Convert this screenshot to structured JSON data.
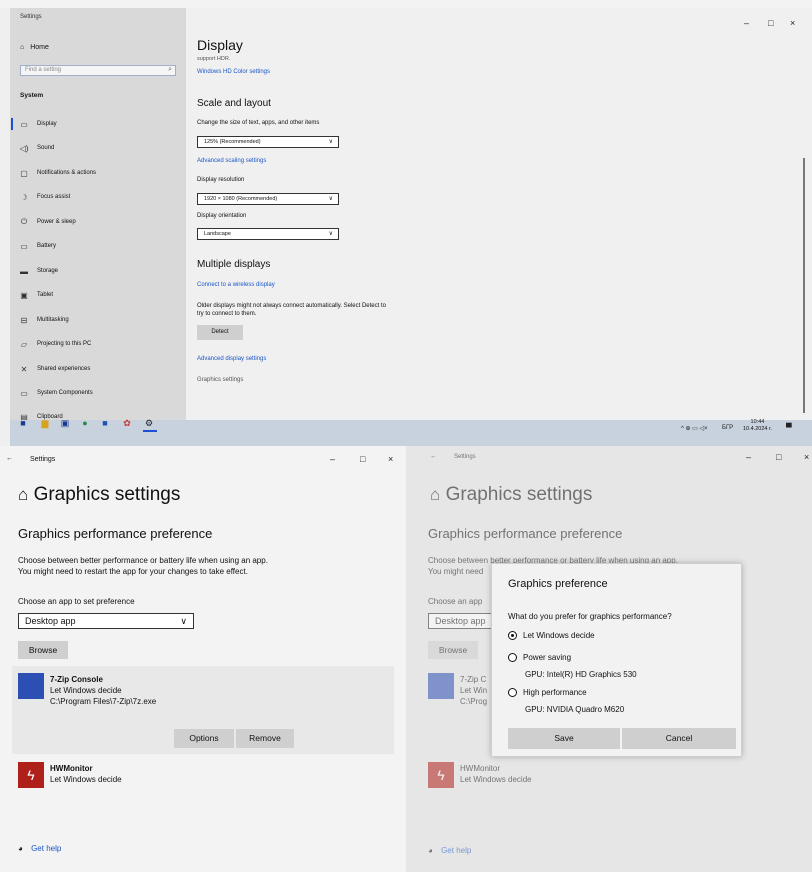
{
  "top_window": {
    "title": "Settings",
    "controls": {
      "minimize": "–",
      "maximize": "□",
      "close": "×"
    },
    "sidebar": {
      "home": "Home",
      "search_placeholder": "Find a setting",
      "section": "System",
      "items": [
        {
          "label": "Display",
          "icon": "monitor-icon"
        },
        {
          "label": "Sound",
          "icon": "speaker-icon"
        },
        {
          "label": "Notifications & actions",
          "icon": "notifications-icon"
        },
        {
          "label": "Focus assist",
          "icon": "moon-icon"
        },
        {
          "label": "Power & sleep",
          "icon": "power-icon"
        },
        {
          "label": "Battery",
          "icon": "battery-icon"
        },
        {
          "label": "Storage",
          "icon": "storage-icon"
        },
        {
          "label": "Tablet",
          "icon": "tablet-icon"
        },
        {
          "label": "Multitasking",
          "icon": "multitasking-icon"
        },
        {
          "label": "Projecting to this PC",
          "icon": "projecting-icon"
        },
        {
          "label": "Shared experiences",
          "icon": "shared-icon"
        },
        {
          "label": "System Components",
          "icon": "components-icon"
        },
        {
          "label": "Clipboard",
          "icon": "clipboard-icon"
        }
      ]
    },
    "main": {
      "title": "Display",
      "cutoff_text": "support HDR.",
      "hd_color_link": "Windows HD Color settings",
      "scale_heading": "Scale and layout",
      "scale_label": "Change the size of text, apps, and other items",
      "scale_value": "125% (Recommended)",
      "advanced_scaling_link": "Advanced scaling settings",
      "resolution_label": "Display resolution",
      "resolution_value": "1920 × 1080 (Recommended)",
      "orientation_label": "Display orientation",
      "orientation_value": "Landscape",
      "multiple_heading": "Multiple displays",
      "wireless_link": "Connect to a wireless display",
      "older_text_1": "Older displays might not always connect automatically. Select Detect to",
      "older_text_2": "try to connect to them.",
      "detect_button": "Detect",
      "advanced_display_link": "Advanced display settings",
      "graphics_settings_link": "Graphics settings"
    },
    "taskbar": {
      "language": "БГР",
      "time": "10:44",
      "date": "10.4.2024 г."
    }
  },
  "left_panel": {
    "header_title": "Settings",
    "controls": {
      "minimize": "–",
      "maximize": "□",
      "close": "×"
    },
    "page_title": "Graphics settings",
    "section_heading": "Graphics performance preference",
    "desc_1": "Choose between better performance or battery life when using an app.",
    "desc_2": "You might need to restart the app for your changes to take effect.",
    "choose_label": "Choose an app to set preference",
    "app_type_value": "Desktop app",
    "browse_button": "Browse",
    "apps": [
      {
        "name": "7-Zip Console",
        "preference": "Let Windows decide",
        "path": "C:\\Program Files\\7-Zip\\7z.exe"
      },
      {
        "name": "HWMonitor",
        "preference": "Let Windows decide"
      }
    ],
    "options_button": "Options",
    "remove_button": "Remove",
    "get_help": "Get help"
  },
  "right_panel": {
    "header_title": "Settings",
    "controls": {
      "minimize": "–",
      "maximize": "□",
      "close": "×"
    },
    "page_title": "Graphics settings",
    "section_heading": "Graphics performance preference",
    "desc_1": "Choose between better performance or battery life when using an app.",
    "desc_2": "You might need",
    "choose_label": "Choose an app",
    "app_type_value": "Desktop app",
    "browse_button": "Browse",
    "app1_name": "7-Zip C",
    "app1_pref": "Let Win",
    "app1_path": "C:\\Prog",
    "app2_name": "HWMonitor",
    "app2_pref": "Let Windows decide",
    "get_help": "Get help",
    "dialog": {
      "title": "Graphics preference",
      "question": "What do you prefer for graphics performance?",
      "options": [
        {
          "label": "Let Windows decide",
          "selected": true,
          "gpu": ""
        },
        {
          "label": "Power saving",
          "selected": false,
          "gpu": "GPU: Intel(R) HD Graphics 530"
        },
        {
          "label": "High performance",
          "selected": false,
          "gpu": "GPU: NVIDIA Quadro M620"
        }
      ],
      "save_button": "Save",
      "cancel_button": "Cancel"
    }
  },
  "colors": {
    "accent": "#1a56c9",
    "app_icon_blue": "#2b4fb3",
    "hwmonitor_red": "#b0201a"
  }
}
